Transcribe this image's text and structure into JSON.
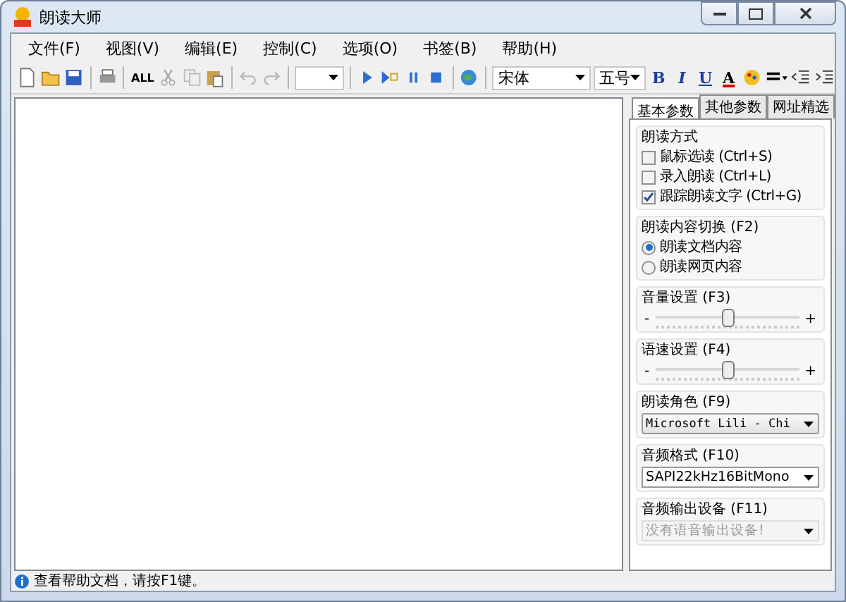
{
  "window": {
    "title": "朗读大师"
  },
  "menu": [
    "文件(F)",
    "视图(V)",
    "编辑(E)",
    "控制(C)",
    "选项(O)",
    "书签(B)",
    "帮助(H)"
  ],
  "toolbar": {
    "select_all": "ALL",
    "font": "宋体",
    "size": "五号",
    "format": [
      "B",
      "I",
      "U",
      "A"
    ]
  },
  "panel": {
    "tabs": [
      {
        "label": "基本参数",
        "selected": true
      },
      {
        "label": "其他参数",
        "selected": false
      },
      {
        "label": "网址精选",
        "selected": false
      }
    ],
    "groups": [
      {
        "kind": "checks",
        "title": "朗读方式",
        "items": [
          {
            "label": "鼠标选读 (Ctrl+S)",
            "checked": false
          },
          {
            "label": "录入朗读 (Ctrl+L)",
            "checked": false
          },
          {
            "label": "跟踪朗读文字 (Ctrl+G)",
            "checked": true
          }
        ]
      },
      {
        "kind": "radios",
        "title": "朗读内容切换 (F2)",
        "items": [
          {
            "label": "朗读文档内容",
            "selected": true
          },
          {
            "label": "朗读网页内容",
            "selected": false
          }
        ]
      },
      {
        "kind": "slider",
        "title": "音量设置 (F3)",
        "minus": "-",
        "plus": "+",
        "level": 0.5
      },
      {
        "kind": "slider",
        "title": "语速设置 (F4)",
        "minus": "-",
        "plus": "+",
        "level": 0.5
      },
      {
        "kind": "combo",
        "title": "朗读角色 (F9)",
        "value": "Microsoft Lili - Chi",
        "disabled": false,
        "raised": true
      },
      {
        "kind": "combo",
        "title": "音频格式 (F10)",
        "value": "SAPI22kHz16BitMono",
        "disabled": false,
        "raised": false
      },
      {
        "kind": "combo",
        "title": "音频输出设备 (F11)",
        "value": "没有语音输出设备!",
        "disabled": true,
        "raised": false
      }
    ]
  },
  "status_bar": {
    "text": "查看帮助文档，请按F1键。"
  }
}
